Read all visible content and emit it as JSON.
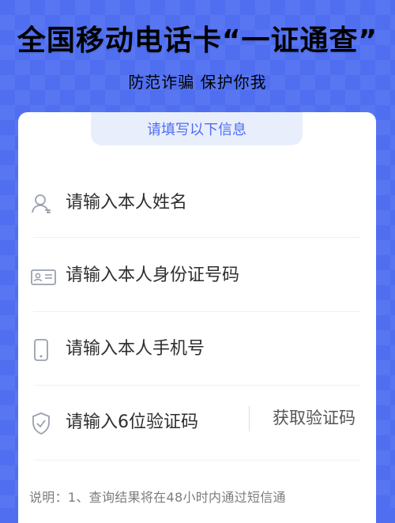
{
  "header": {
    "title": "全国移动电话卡“一证通查”",
    "subtitle": "防范诈骗 保护你我"
  },
  "form": {
    "tab_title": "请填写以下信息",
    "fields": [
      {
        "placeholder": "请输入本人姓名",
        "icon": "user-icon"
      },
      {
        "placeholder": "请输入本人身份证号码",
        "icon": "id-card-icon"
      },
      {
        "placeholder": "请输入本人手机号",
        "icon": "phone-icon"
      },
      {
        "placeholder": "请输入6位验证码",
        "icon": "shield-check-icon"
      }
    ],
    "otp_button": "获取验证码",
    "note": "说明：1、查询结果将在48小时内通过短信通"
  },
  "colors": {
    "background": "#4f6ff0",
    "accent": "#4e6df3",
    "tab_bg": "#e8eefc"
  }
}
